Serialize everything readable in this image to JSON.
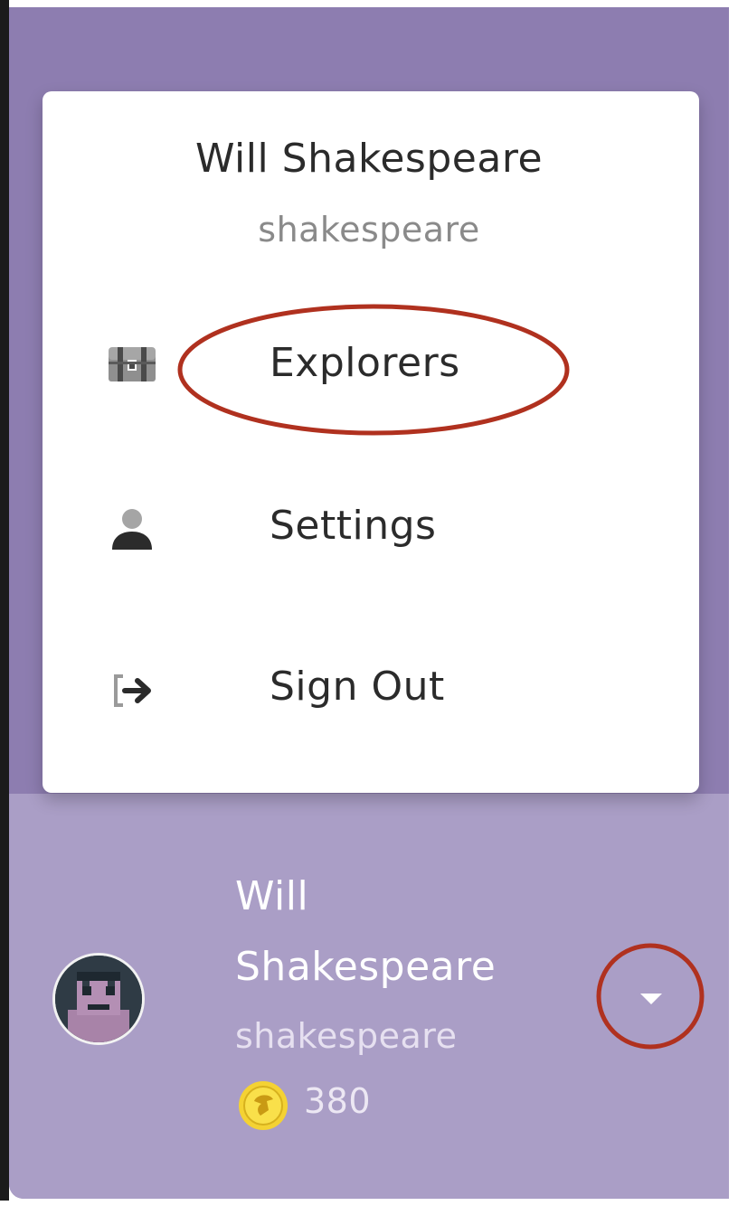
{
  "menu": {
    "display_name": "Will Shakespeare",
    "username": "shakespeare",
    "items": [
      {
        "label": "Explorers",
        "icon": "treasure-chest-icon"
      },
      {
        "label": "Settings",
        "icon": "user-icon"
      },
      {
        "label": "Sign Out",
        "icon": "sign-out-icon"
      }
    ]
  },
  "profile": {
    "name_line1": "Will",
    "name_line2": "Shakespeare",
    "username": "shakespeare",
    "coins": "380",
    "coin_icon": "coin-icon",
    "dropdown_icon": "caret-down-icon"
  },
  "colors": {
    "sidebar_bg": "#8d7db0",
    "profile_bg": "#aa9ec6",
    "highlight": "#b0311f",
    "coin": "#f4d233"
  }
}
